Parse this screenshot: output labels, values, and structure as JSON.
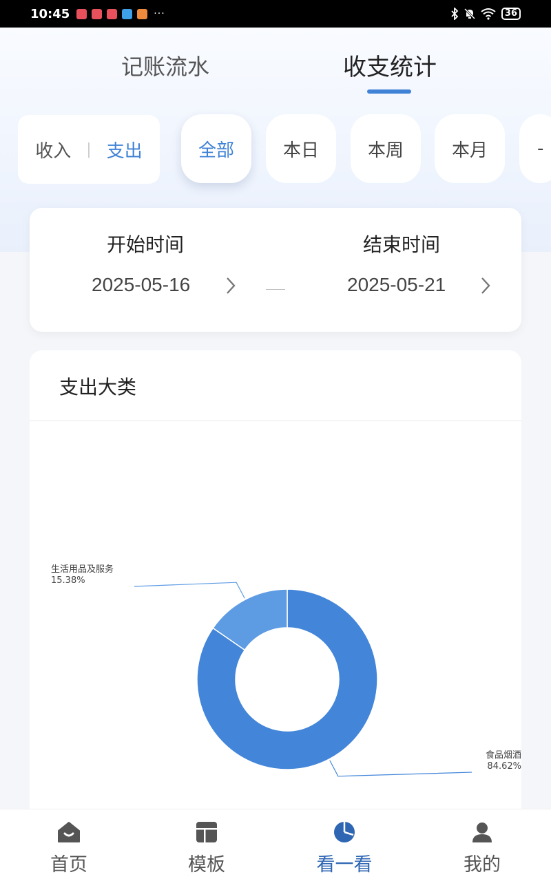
{
  "status_bar": {
    "time": "10:45",
    "more": "···",
    "battery": "36"
  },
  "tabs": {
    "ledger": "记账流水",
    "stats": "收支统计",
    "active": "stats"
  },
  "type_toggle": {
    "income": "收入",
    "separator": "|",
    "expense": "支出",
    "selected": "expense"
  },
  "periods": {
    "all": "全部",
    "day": "本日",
    "week": "本周",
    "month": "本月",
    "more": "-",
    "selected": "all"
  },
  "date_range": {
    "start_label": "开始时间",
    "start_value": "2025-05-16",
    "end_label": "结束时间",
    "end_value": "2025-05-21"
  },
  "chart_section": {
    "title": "支出大类"
  },
  "chart_data": {
    "type": "pie",
    "donut": true,
    "slices": [
      {
        "name": "食品烟酒",
        "percent_label": "84.62%",
        "value": 84.62,
        "color": "#4285d9"
      },
      {
        "name": "生活用品及服务",
        "percent_label": "15.38%",
        "value": 15.38,
        "color": "#5d9be3"
      }
    ]
  },
  "bottom_nav": {
    "home": "首页",
    "template": "模板",
    "view": "看一看",
    "mine": "我的",
    "active": "view",
    "icons": {
      "home": "home-icon",
      "template": "template-icon",
      "view": "pie-chart-icon",
      "mine": "user-icon"
    }
  },
  "colors": {
    "accent": "#3f82d6",
    "nav_active": "#2f66b3"
  }
}
